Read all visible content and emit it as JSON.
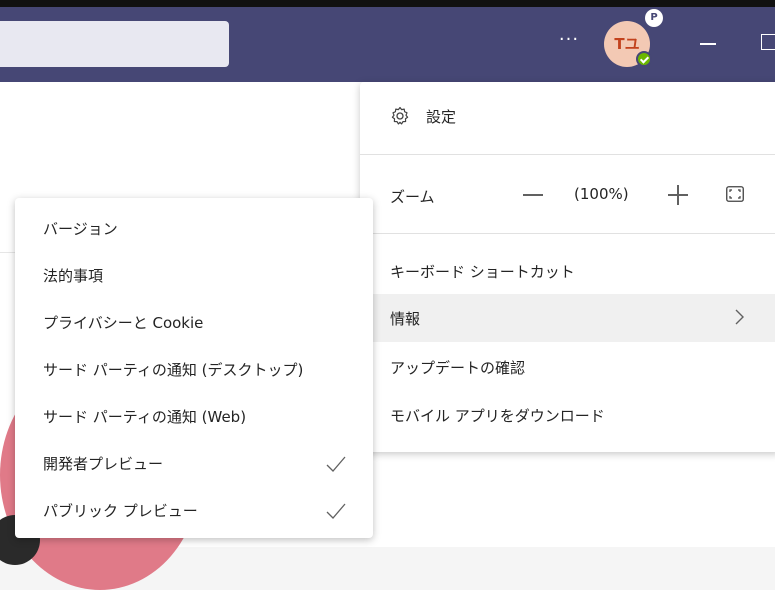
{
  "topbar": {
    "more_label": "···",
    "avatar_initials": "Tユ",
    "avatar_badge": "P",
    "presence_status": "available"
  },
  "settings_menu": {
    "settings_label": "設定",
    "zoom_label": "ズーム",
    "zoom_value": "(100%)",
    "items": [
      {
        "label": "キーボード ショートカット"
      },
      {
        "label": "情報",
        "highlighted": true
      },
      {
        "label": "アップデートの確認"
      },
      {
        "label": "モバイル アプリをダウンロード"
      }
    ]
  },
  "info_submenu": {
    "items": [
      {
        "label": "バージョン",
        "checked": false
      },
      {
        "label": "法的事項",
        "checked": false
      },
      {
        "label": "プライバシーと Cookie",
        "checked": false
      },
      {
        "label": "サード パーティの通知 (デスクトップ)",
        "checked": false
      },
      {
        "label": "サード パーティの通知 (Web)",
        "checked": false
      },
      {
        "label": "開発者プレビュー",
        "checked": true
      },
      {
        "label": "パブリック プレビュー",
        "checked": true
      }
    ]
  },
  "colors": {
    "titlebar": "#464775",
    "presence": "#6bb700",
    "avatar_bg": "#f3c9b4",
    "accent_blob": "#e07a88"
  }
}
